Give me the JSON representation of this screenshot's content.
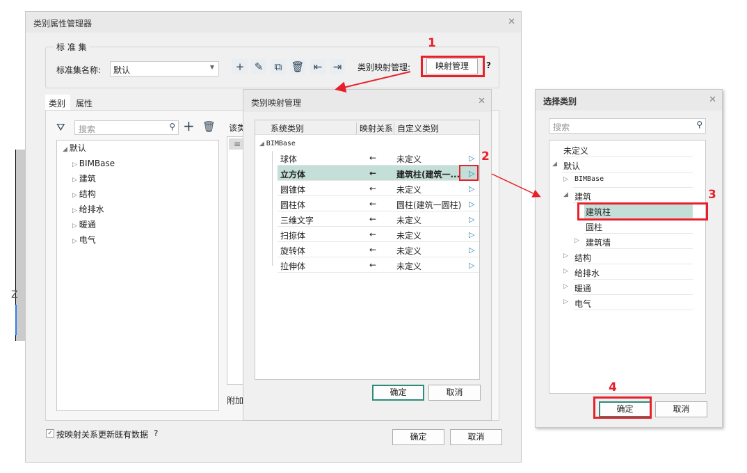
{
  "main": {
    "title": "类别属性管理器",
    "group_label": "标 准 集",
    "set_name_label": "标准集名称:",
    "set_name_value": "默认",
    "mapping_label": "类别映射管理:",
    "mapping_button": "映射管理",
    "help": "?",
    "tabs": [
      "类别",
      "属性"
    ],
    "search_placeholder": "搜索",
    "tree_root": "默认",
    "tree_items": [
      "BIMBase",
      "建筑",
      "结构",
      "给排水",
      "暖通",
      "电气"
    ],
    "right_label": "该类",
    "attach_label": "附加",
    "checkbox_label": "按映射关系更新既有数据",
    "checkbox_checked": true,
    "ok": "确定",
    "cancel": "取消",
    "axis_label": "Z"
  },
  "mapping": {
    "title": "类别映射管理",
    "headers": [
      "系统类别",
      "映射关系",
      "自定义类别"
    ],
    "root": "BIMBase",
    "rows": [
      {
        "sys": "球体",
        "rel": "←",
        "custom": "未定义"
      },
      {
        "sys": "立方体",
        "rel": "←",
        "custom": "建筑柱(建筑一...",
        "selected": true
      },
      {
        "sys": "圆锥体",
        "rel": "←",
        "custom": "未定义"
      },
      {
        "sys": "圆柱体",
        "rel": "←",
        "custom": "圆柱(建筑一圆柱)"
      },
      {
        "sys": "三维文字",
        "rel": "←",
        "custom": "未定义"
      },
      {
        "sys": "扫掠体",
        "rel": "←",
        "custom": "未定义"
      },
      {
        "sys": "旋转体",
        "rel": "←",
        "custom": "未定义"
      },
      {
        "sys": "拉伸体",
        "rel": "←",
        "custom": "未定义"
      }
    ],
    "ok": "确定",
    "cancel": "取消"
  },
  "select": {
    "title": "选择类别",
    "search_placeholder": "搜索",
    "items": [
      {
        "label": "未定义",
        "level": 0,
        "exp": ""
      },
      {
        "label": "默认",
        "level": 0,
        "exp": "open"
      },
      {
        "label": "BIMBase",
        "level": 1,
        "exp": "closed"
      },
      {
        "label": "建筑",
        "level": 1,
        "exp": "open"
      },
      {
        "label": "建筑柱",
        "level": 2,
        "exp": "",
        "selected": true
      },
      {
        "label": "圆柱",
        "level": 2,
        "exp": ""
      },
      {
        "label": "建筑墙",
        "level": 2,
        "exp": "closed"
      },
      {
        "label": "结构",
        "level": 1,
        "exp": "closed"
      },
      {
        "label": "给排水",
        "level": 1,
        "exp": "closed"
      },
      {
        "label": "暖通",
        "level": 1,
        "exp": "closed"
      },
      {
        "label": "电气",
        "level": 1,
        "exp": "closed"
      }
    ],
    "ok": "确定",
    "cancel": "取消"
  },
  "steps": [
    "1",
    "2",
    "3",
    "4"
  ],
  "colors": {
    "accent": "#2e8b7a",
    "highlight": "#c4ded8",
    "annotation": "#e8202a"
  }
}
